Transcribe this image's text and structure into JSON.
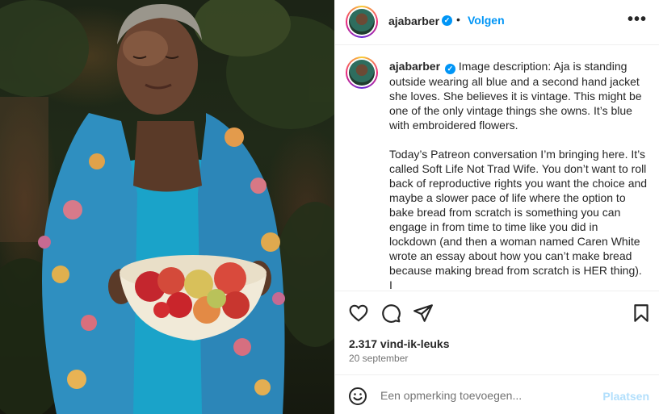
{
  "post": {
    "username": "ajabarber",
    "verified_icon": "verified-badge-icon",
    "follow_label": "Volgen",
    "separator": "•",
    "more_label": "•••"
  },
  "caption": {
    "username": "ajabarber",
    "text": "Image description: Aja is standing outside wearing all blue and a second hand jacket she loves. She believes it is vintage. This might be one of the only vintage things she owns. It’s blue with embroidered flowers.\n\nToday’s Patreon conversation I’m bringing here. It’s called Soft Life Not Trad Wife. You don’t want to roll back of reproductive rights you want the choice and maybe a slower pace of life where the option to bake bread from scratch is something you can engage in from time to time like you did in lockdown (and then a woman named Caren White wrote an essay about how you can’t make bread because making bread from scratch is HER thing). I"
  },
  "actions": {
    "like_icon": "heart-icon",
    "comment_icon": "comment-icon",
    "share_icon": "send-icon",
    "save_icon": "bookmark-icon"
  },
  "stats": {
    "likes": "2.317 vind-ik-leuks",
    "date": "20 september"
  },
  "comment": {
    "placeholder": "Een opmerking toevoegen...",
    "post_label": "Plaatsen",
    "emoji_icon": "emoji-icon"
  },
  "colors": {
    "accent": "#0095f6",
    "text": "#262626",
    "muted": "#737373",
    "post_disabled": "#b2dffc",
    "border": "#efefef"
  }
}
